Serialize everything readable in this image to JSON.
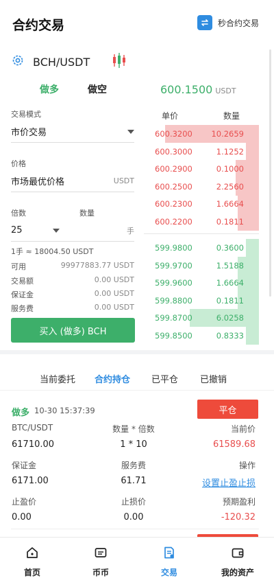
{
  "header": {
    "title": "合约交易",
    "quick_link": "秒合约交易"
  },
  "pair": {
    "symbol": "BCH/USDT"
  },
  "order_form": {
    "tab_long": "做多",
    "tab_short": "做空",
    "mode_label": "交易模式",
    "mode_value": "市价交易",
    "price_label": "价格",
    "price_value": "市场最优价格",
    "price_unit": "USDT",
    "multiple_label": "倍数",
    "qty_label": "数量",
    "multiple_value": "25",
    "qty_unit": "手",
    "lot_info": "1手 ≈ 18004.50 USDT",
    "info": [
      {
        "label": "可用",
        "value": "99977883.77 USDT"
      },
      {
        "label": "交易额",
        "value": "0.00 USDT"
      },
      {
        "label": "保证金",
        "value": "0.00 USDT"
      },
      {
        "label": "服务费",
        "value": "0.00 USDT"
      }
    ],
    "buy_button": "买入 (做多) BCH"
  },
  "orderbook": {
    "last_price": "600.1500",
    "last_unit": "USDT",
    "head_price": "单价",
    "head_qty": "数量",
    "asks": [
      {
        "price": "600.3200",
        "qty": "10.2659",
        "depth": 0.88
      },
      {
        "price": "600.3000",
        "qty": "1.1252",
        "depth": 0.12
      },
      {
        "price": "600.2900",
        "qty": "0.1000",
        "depth": 0.22
      },
      {
        "price": "600.2500",
        "qty": "2.2560",
        "depth": 0.22
      },
      {
        "price": "600.2300",
        "qty": "1.6664",
        "depth": 0.2
      },
      {
        "price": "600.2200",
        "qty": "0.1811",
        "depth": 0.2
      }
    ],
    "bids": [
      {
        "price": "599.9800",
        "qty": "0.3600",
        "depth": 0.12
      },
      {
        "price": "599.9700",
        "qty": "1.5188",
        "depth": 0.2
      },
      {
        "price": "599.9600",
        "qty": "1.6664",
        "depth": 0.2
      },
      {
        "price": "599.8800",
        "qty": "0.1811",
        "depth": 0.2
      },
      {
        "price": "599.8700",
        "qty": "6.0258",
        "depth": 0.65
      },
      {
        "price": "599.8500",
        "qty": "0.8333",
        "depth": 0.12
      }
    ]
  },
  "position_tabs": [
    "当前委托",
    "合约持仓",
    "已平仓",
    "已撤销"
  ],
  "position": {
    "side": "做多",
    "time": "10-30 15:37:39",
    "close_button": "平仓",
    "symbol_label": "BTC/USDT",
    "qty_label": "数量 * 倍数",
    "current_price_label": "当前价",
    "open_price": "61710.00",
    "qty_value": "1 * 10",
    "current_price": "61589.68",
    "margin_label": "保证金",
    "fee_label": "服务费",
    "action_label": "操作",
    "margin_value": "6171.00",
    "fee_value": "61.71",
    "action_link": "设置止盈止损",
    "tp_label": "止盈价",
    "sl_label": "止损价",
    "pnl_label": "预期盈利",
    "tp_value": "0.00",
    "sl_value": "0.00",
    "pnl_value": "-120.32"
  },
  "nav": [
    {
      "label": "首页",
      "icon": "home-icon"
    },
    {
      "label": "币币",
      "icon": "wallet-card-icon"
    },
    {
      "label": "交易",
      "icon": "trade-doc-icon"
    },
    {
      "label": "我的资产",
      "icon": "assets-wallet-icon"
    }
  ],
  "colors": {
    "green": "#3daf6a",
    "red": "#e84e4e",
    "blue": "#2f8ce0"
  }
}
